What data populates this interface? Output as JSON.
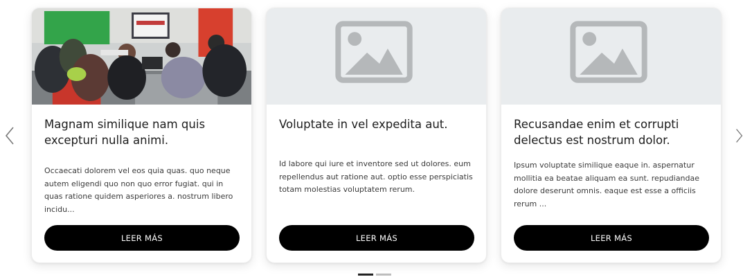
{
  "carousel": {
    "prev_icon": "chevron-left-icon",
    "next_icon": "chevron-right-icon",
    "cards": [
      {
        "image": "classroom-photo",
        "title": "Magnam similique nam quis excepturi nulla animi.",
        "text": "Occaecati dolorem vel eos quia quas. quo neque autem eligendi quo non quo error fugiat. qui in quas ratione quidem asperiores a. nostrum libero incidu...",
        "button_label": "LEER MÁS"
      },
      {
        "image": "image-placeholder-icon",
        "title": "Voluptate in vel expedita aut.",
        "text": "Id labore qui iure et inventore sed ut dolores. eum repellendus aut ratione aut. optio esse perspiciatis totam molestias voluptatem rerum.",
        "button_label": "LEER MÁS"
      },
      {
        "image": "image-placeholder-icon",
        "title": "Recusandae enim et corrupti delectus est nostrum dolor.",
        "text": "Ipsum voluptate similique eaque in. aspernatur mollitia ea beatae aliquam ea sunt. repudiandae dolore deserunt omnis. eaque est esse a officiis rerum ...",
        "button_label": "LEER MÁS"
      }
    ],
    "pagination": {
      "pages": 2,
      "active": 1
    }
  },
  "colors": {
    "button_bg": "#000000",
    "button_text": "#ffffff",
    "placeholder_bg": "#e9ecee",
    "placeholder_icon": "#b5b8ba",
    "dot_active": "#222222",
    "dot_inactive": "#bdbdbd"
  }
}
